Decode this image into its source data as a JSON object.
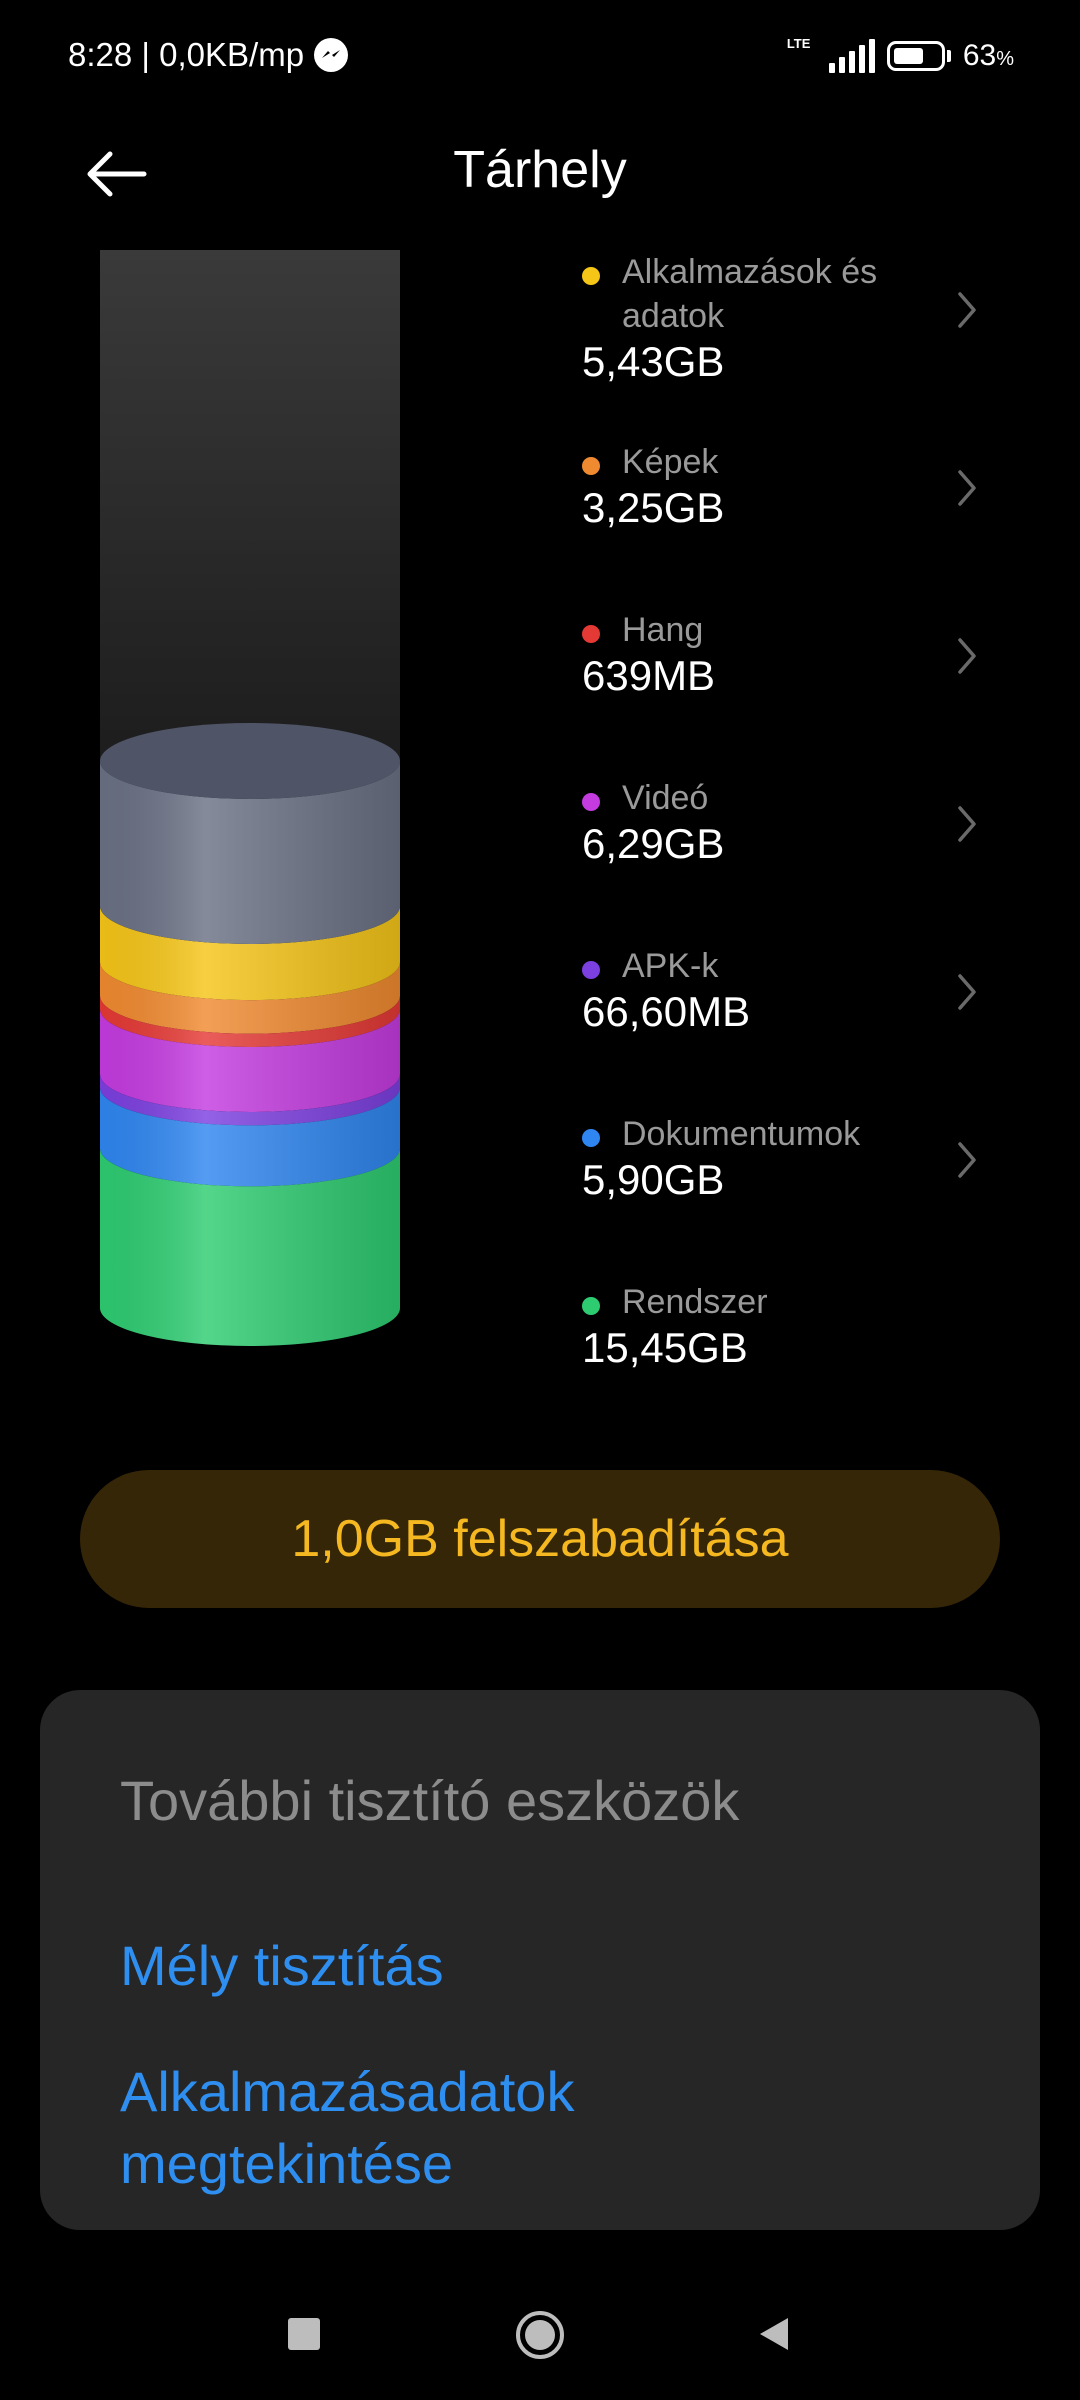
{
  "status_bar": {
    "time_and_speed": "8:28 | 0,0KB/mp",
    "network": "LTE",
    "battery_percent": "63",
    "battery_unit": "%",
    "battery_level": 0.63
  },
  "header": {
    "title": "Tárhely"
  },
  "chart_data": {
    "type": "bar",
    "categories": [
      "Alkalmazások és adatok",
      "Képek",
      "Hang",
      "Videó",
      "APK-k",
      "Dokumentumok",
      "Rendszer"
    ],
    "values_gb": [
      5.43,
      3.25,
      0.639,
      6.29,
      0.0666,
      5.9,
      15.45
    ],
    "colors": [
      "#f5c518",
      "#f08a30",
      "#e53935",
      "#c43be0",
      "#7c3fe0",
      "#2f86f0",
      "#2ecc71"
    ]
  },
  "legend": [
    {
      "name": "Alkalmazások és adatok",
      "value": "5,43GB",
      "color": "#f5c518",
      "has_chevron": true
    },
    {
      "name": "Képek",
      "value": "3,25GB",
      "color": "#f08a30",
      "has_chevron": true
    },
    {
      "name": "Hang",
      "value": "639MB",
      "color": "#e53935",
      "has_chevron": true
    },
    {
      "name": "Videó",
      "value": "6,29GB",
      "color": "#c43be0",
      "has_chevron": true
    },
    {
      "name": "APK-k",
      "value": "66,60MB",
      "color": "#7c3fe0",
      "has_chevron": true
    },
    {
      "name": "Dokumentumok",
      "value": "5,90GB",
      "color": "#2f86f0",
      "has_chevron": true
    },
    {
      "name": "Rendszer",
      "value": "15,45GB",
      "color": "#2ecc71",
      "has_chevron": false
    }
  ],
  "free_button": {
    "label": "1,0GB felszabadítása"
  },
  "tools_card": {
    "title": "További tisztító eszközök",
    "links": [
      "Mély tisztítás",
      "Alkalmazásadatok megtekintése"
    ]
  },
  "nav_bar": {
    "icons": [
      "recents-square-icon",
      "home-circle-icon",
      "back-triangle-icon"
    ]
  }
}
